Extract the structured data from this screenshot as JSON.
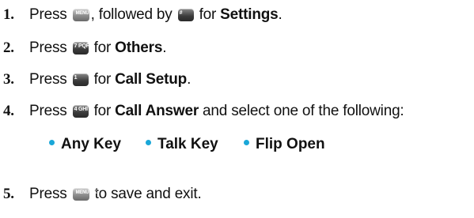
{
  "steps": [
    {
      "num": "1.",
      "a": "Press",
      "b": ", followed by",
      "c": "for",
      "d": "Settings",
      "e": ".",
      "key1": "MENU OK",
      "key2": "#"
    },
    {
      "num": "2.",
      "a": "Press",
      "c": "for",
      "d": "Others",
      "e": ".",
      "key1": "7 PQRS"
    },
    {
      "num": "3.",
      "a": "Press",
      "c": "for",
      "d": "Call Setup",
      "e": ".",
      "key1": "1"
    },
    {
      "num": "4.",
      "a": "Press",
      "c": "for",
      "d": "Call Answer",
      "e": "and select one of the following:",
      "key1": "4 GHI"
    },
    {
      "num": "5.",
      "a": "Press",
      "c": "to save and exit.",
      "key1": "MENU OK"
    }
  ],
  "options": [
    "Any Key",
    "Talk Key",
    "Flip Open"
  ],
  "colors": {
    "bullet": "#1aa7d8",
    "text": "#111111"
  }
}
